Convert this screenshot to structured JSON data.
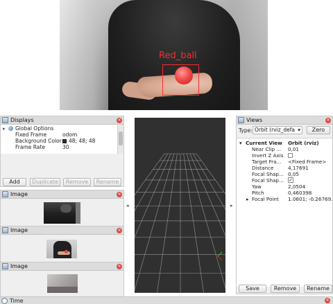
{
  "camera": {
    "detection_label": "Red_ball"
  },
  "displays": {
    "title": "Displays",
    "tree": [
      {
        "label": "Global Options",
        "value": ""
      },
      {
        "label": "Fixed Frame",
        "value": "odom"
      },
      {
        "label": "Background Color",
        "value": "48; 48; 48"
      },
      {
        "label": "Frame Rate",
        "value": "30"
      }
    ],
    "buttons": {
      "add": "Add",
      "duplicate": "Duplicate",
      "remove": "Remove",
      "rename": "Rename"
    }
  },
  "image_panels": [
    {
      "title": "Image"
    },
    {
      "title": "Image"
    },
    {
      "title": "Image"
    }
  ],
  "views": {
    "title": "Views",
    "type_label": "Type:",
    "type_value": "Orbit (rviz_defa",
    "zero_button": "Zero",
    "current_view": {
      "label": "Current View",
      "value": "Orbit (rviz)"
    },
    "props": [
      {
        "label": "Near Clip ...",
        "value": "0,01"
      },
      {
        "label": "Invert Z Axis",
        "value": ""
      },
      {
        "label": "Target Fra...",
        "value": "<Fixed Frame>"
      },
      {
        "label": "Distance",
        "value": "4,17691"
      },
      {
        "label": "Focal Shap...",
        "value": "0,05"
      },
      {
        "label": "Focal Shap...",
        "value": "✓"
      },
      {
        "label": "Yaw",
        "value": "2,0504"
      },
      {
        "label": "Pitch",
        "value": "0,460398"
      },
      {
        "label": "Focal Point",
        "value": "1.0601; -0.26769..."
      }
    ],
    "buttons": {
      "save": "Save",
      "remove": "Remove",
      "rename": "Rename"
    }
  },
  "time": {
    "title": "Time"
  }
}
